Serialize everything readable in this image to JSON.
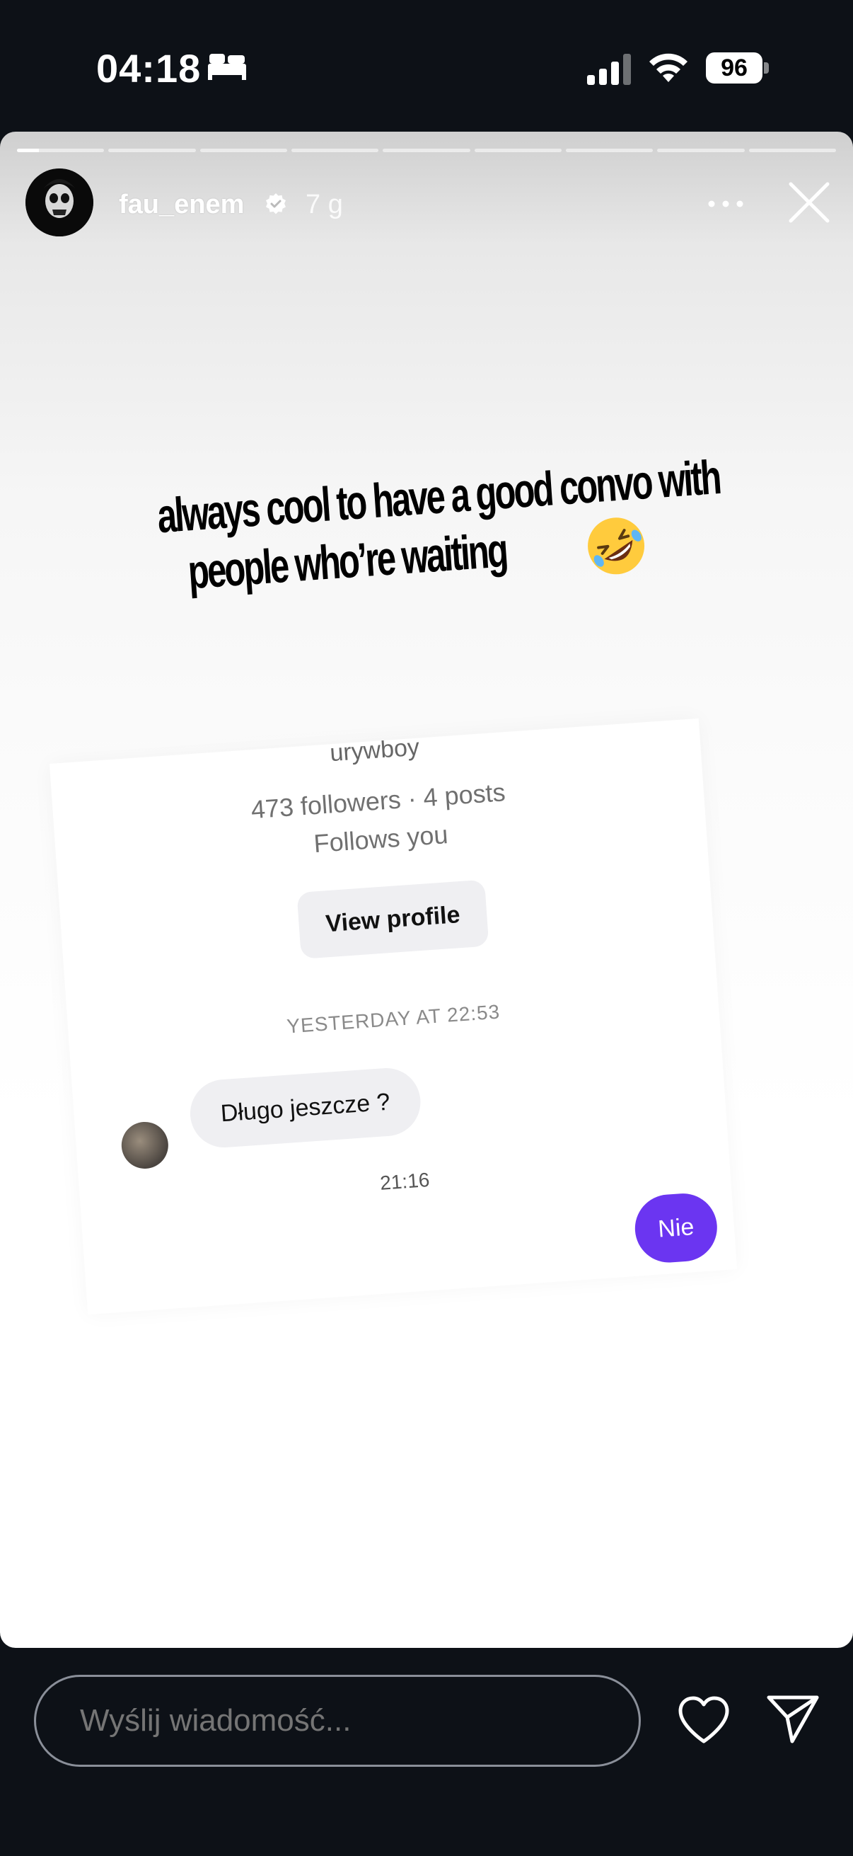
{
  "status_bar": {
    "time": "04:18",
    "battery": "96",
    "icons": [
      "bed-icon",
      "signal-icon",
      "wifi-icon",
      "battery-icon"
    ]
  },
  "story": {
    "progress": {
      "segments": 9,
      "current": 1,
      "current_fraction": 0.25
    },
    "user": {
      "username": "fau_enem",
      "verified": true,
      "time_ago": "7 g"
    },
    "header_icons": [
      "more-icon",
      "close-icon"
    ],
    "caption": {
      "line1": "always cool to have a good convo with",
      "line2": "people who’re waiting",
      "emoji": "rolling-on-floor-laughing-emoji"
    },
    "screenshot": {
      "cut_off_name": "urywboy",
      "stats": "473 followers · 4 posts",
      "follows": "Follows you",
      "view_profile": "View profile",
      "date": "YESTERDAY AT 22:53",
      "incoming_message": "Długo jeszcze ?",
      "time": "21:16",
      "outgoing_message": "Nie"
    }
  },
  "bottom_bar": {
    "message_placeholder": "Wyślij wiadomość...",
    "icons": [
      "heart-icon",
      "send-icon"
    ]
  },
  "colors": {
    "background": "#0d1117",
    "outgoing_bubble": "#6b35f1",
    "incoming_bubble": "#efeff2"
  }
}
